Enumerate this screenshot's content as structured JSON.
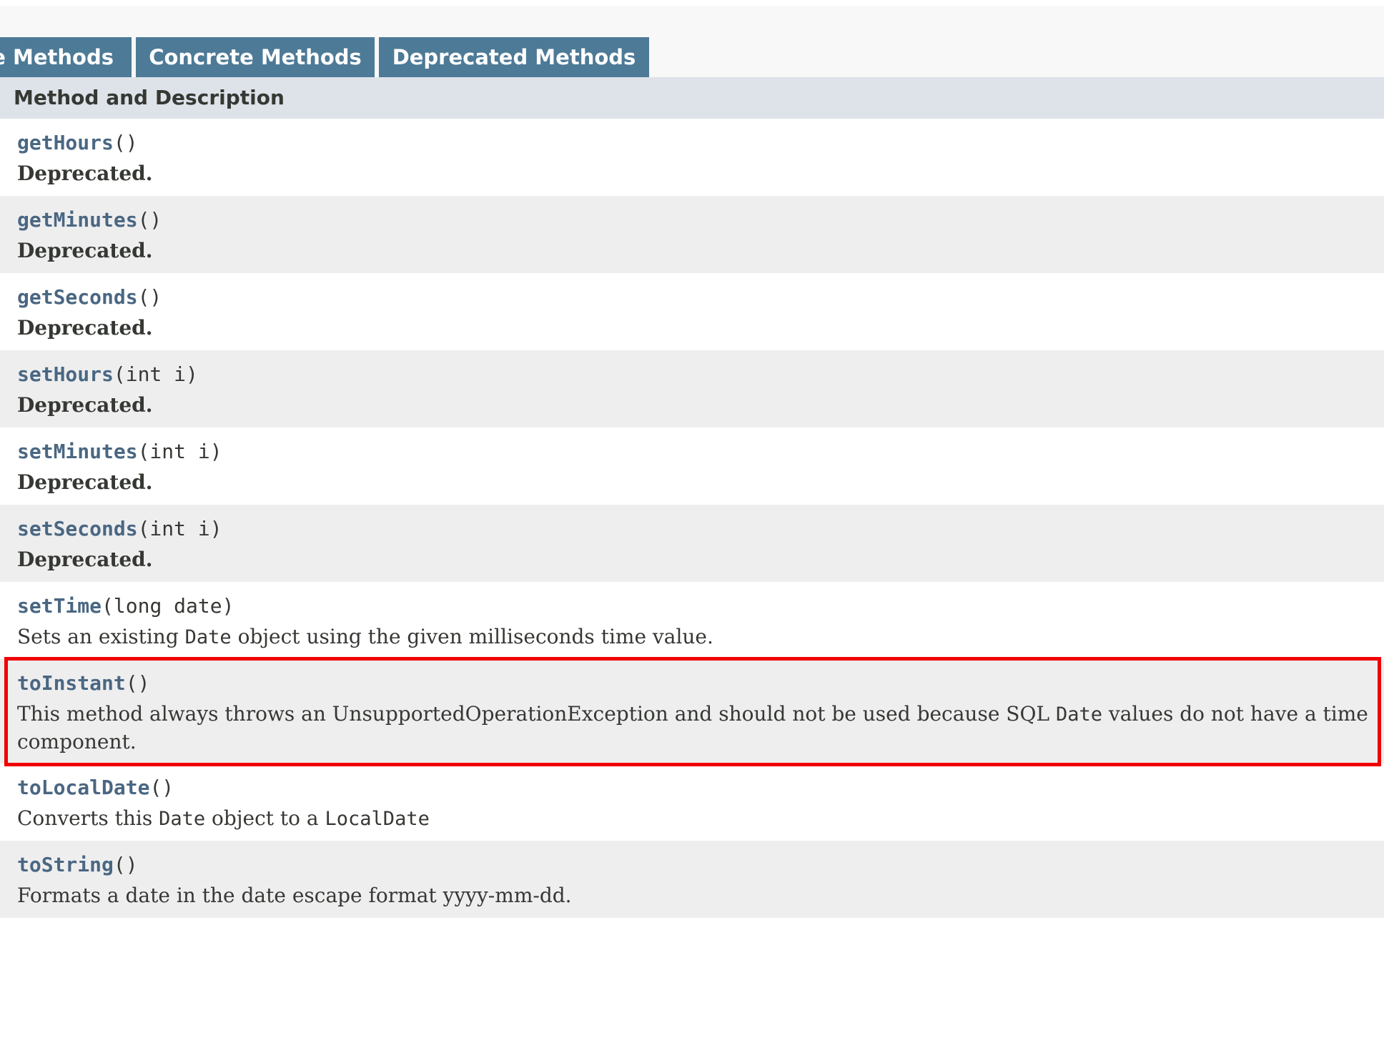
{
  "tabs": [
    {
      "label": "e Methods"
    },
    {
      "label": "Concrete Methods"
    },
    {
      "label": "Deprecated Methods"
    }
  ],
  "table_header": "Method and Description",
  "methods": [
    {
      "name": "getHours",
      "params": "()",
      "desc": "Deprecated."
    },
    {
      "name": "getMinutes",
      "params": "()",
      "desc": "Deprecated."
    },
    {
      "name": "getSeconds",
      "params": "()",
      "desc": "Deprecated."
    },
    {
      "name": "setHours",
      "params": "(int i)",
      "desc": "Deprecated."
    },
    {
      "name": "setMinutes",
      "params": "(int i)",
      "desc": "Deprecated."
    },
    {
      "name": "setSeconds",
      "params": "(int i)",
      "desc": "Deprecated."
    },
    {
      "name": "setTime",
      "params": "(long date)",
      "desc_parts": [
        "Sets an existing ",
        "Date",
        " object using the given milliseconds time value."
      ]
    },
    {
      "name": "toInstant",
      "params": "()",
      "desc_parts": [
        "This method always throws an UnsupportedOperationException and should not be used because SQL ",
        "Date",
        " values do not have a time component."
      ]
    },
    {
      "name": "toLocalDate",
      "params": "()",
      "desc_parts": [
        "Converts this ",
        "Date",
        " object to a ",
        "LocalDate",
        ""
      ]
    },
    {
      "name": "toString",
      "params": "()",
      "desc": "Formats a date in the date escape format yyyy-mm-dd."
    }
  ],
  "colors": {
    "tab_bg": "#4d7a97",
    "header_bg": "#dee3e9",
    "alt_row_bg": "#eeeeef",
    "link": "#4a6782",
    "highlight": "#f00000"
  }
}
